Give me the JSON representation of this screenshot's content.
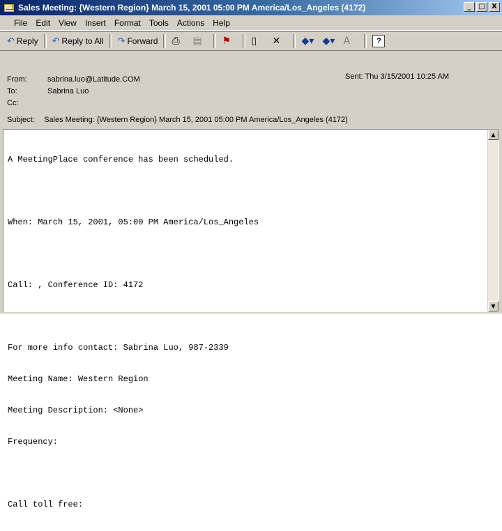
{
  "window": {
    "title": "Sales Meeting: {Western Region} March 15, 2001 05:00 PM America/Los_Angeles (4172)",
    "minimize": "_",
    "maximize": "□",
    "close": "X"
  },
  "menu": {
    "file": "File",
    "edit": "Edit",
    "view": "View",
    "insert": "Insert",
    "format": "Format",
    "tools": "Tools",
    "actions": "Actions",
    "help": "Help"
  },
  "toolbar": {
    "reply": "Reply",
    "reply_all": "Reply to All",
    "forward": "Forward",
    "icons": [
      "reply-icon",
      "reply-all-icon",
      "forward-icon",
      "print-icon",
      "move-icon",
      "flag-icon",
      "addressbook-icon",
      "delete-icon",
      "previous-icon",
      "next-icon",
      "format-icon",
      "help-icon"
    ]
  },
  "header": {
    "from_label": "From:",
    "from_value": "sabrina.luo@Latitude.COM",
    "to_label": "To:",
    "to_value": "Sabrina Luo",
    "cc_label": "Cc:",
    "cc_value": "",
    "subject_label": "Subject:",
    "subject_value": "Sales Meeting: {Western Region} March 15, 2001 05:00 PM America/Los_Angeles (4172)",
    "sent_label": "Sent:",
    "sent_value": "Thu 3/15/2001 10:25 AM"
  },
  "body": {
    "lines": [
      "A MeetingPlace conference has been scheduled.",
      "",
      "When: March 15, 2001, 05:00 PM America/Los_Angeles",
      "",
      "Call: , Conference ID: 4172",
      "",
      "For more info contact: Sabrina Luo, 987-2339",
      "Meeting Name: Western Region",
      "Meeting Description: <None>",
      "Frequency:",
      "",
      "Call toll free:"
    ]
  }
}
